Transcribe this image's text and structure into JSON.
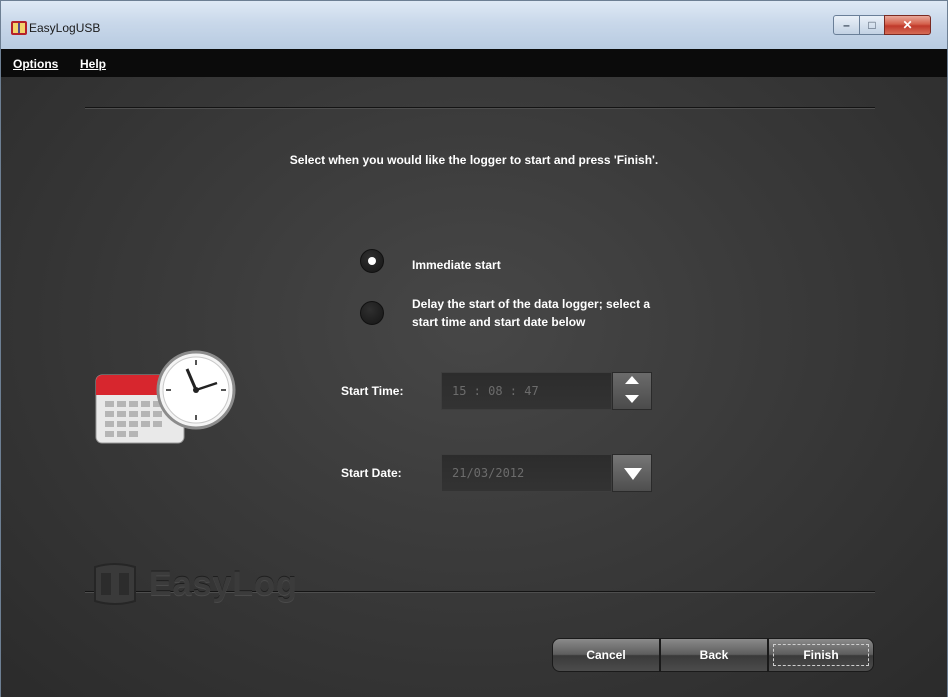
{
  "window": {
    "title": "EasyLogUSB",
    "controls": {
      "minimize": "–",
      "maximize": "□",
      "close": "✕"
    }
  },
  "menu": {
    "items": [
      "Options",
      "Help"
    ]
  },
  "wizard": {
    "instruction": "Select when you would like the logger to start and press 'Finish'.",
    "options": [
      {
        "label": "Immediate start",
        "selected": true
      },
      {
        "label_line1": "Delay the start of the data logger; select a",
        "label_line2": "start time and start date below",
        "selected": false
      }
    ],
    "start_time": {
      "label": "Start Time:",
      "value": "15 : 08 : 47"
    },
    "start_date": {
      "label": "Start Date:",
      "value": "21/03/2012"
    },
    "illustration_icon": "calendar-clock-icon"
  },
  "brand": {
    "logo_text": "EasyLog"
  },
  "buttons": {
    "cancel": "Cancel",
    "back": "Back",
    "finish": "Finish"
  },
  "colors": {
    "background": "#3a3a3a",
    "menubar": "#0b0b0b",
    "text": "#ffffff",
    "close_button": "#c0392b"
  }
}
